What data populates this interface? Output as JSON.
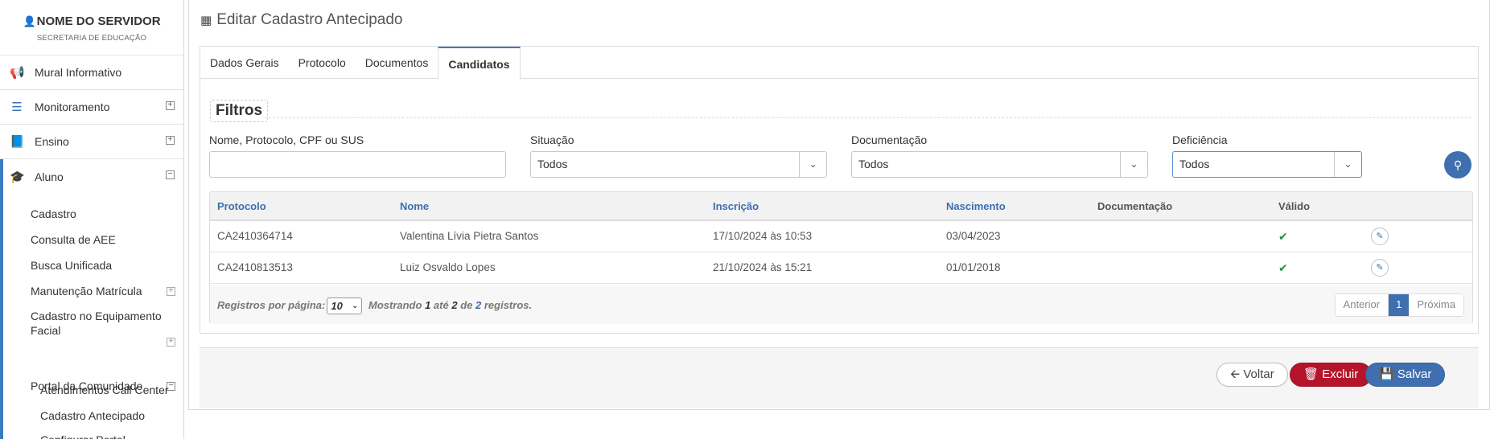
{
  "sidebar": {
    "user_name": "NOME DO SERVIDOR",
    "user_department": "SECRETARIA DE EDUCAÇÃO",
    "items": [
      {
        "label": "Mural Informativo",
        "icon": "megaphone-icon"
      },
      {
        "label": "Monitoramento",
        "icon": "sliders-icon",
        "expand": "⊞"
      },
      {
        "label": "Ensino",
        "icon": "book-icon",
        "expand": "⊞"
      },
      {
        "label": "Aluno",
        "icon": "graduation-cap-icon",
        "expand": "⊟"
      }
    ],
    "sub_items": [
      {
        "label": "Cadastro"
      },
      {
        "label": "Consulta de AEE"
      },
      {
        "label": "Busca Unificada"
      },
      {
        "label": "Manutenção Matrícula"
      },
      {
        "label": "Cadastro no Equipamento Facial"
      },
      {
        "label": "Portal da Comunidade"
      },
      {
        "label": "Atendimentos Call Center"
      },
      {
        "label": "Cadastro Antecipado"
      },
      {
        "label": "Configurar Portal"
      }
    ]
  },
  "page": {
    "title": "Editar Cadastro Antecipado",
    "tabs": [
      "Dados Gerais",
      "Protocolo",
      "Documentos",
      "Candidatos"
    ],
    "active_tab": "Candidatos"
  },
  "filters": {
    "legend": "Filtros",
    "name_label": "Nome, Protocolo, CPF ou SUS",
    "name_value": "",
    "situacao_label": "Situação",
    "situacao_value": "Todos",
    "documentacao_label": "Documentação",
    "documentacao_value": "Todos",
    "deficiencia_label": "Deficiência",
    "deficiencia_value": "Todos"
  },
  "table": {
    "headers": [
      "Protocolo",
      "Nome",
      "Inscrição",
      "Nascimento",
      "Documentação",
      "Válido"
    ],
    "rows": [
      {
        "protocolo": "CA2410364714",
        "nome": "Valentina Lívia Pietra Santos",
        "inscricao": "17/10/2024 às 10:53",
        "nascimento": "03/04/2023",
        "documentacao": "",
        "valido": "✔"
      },
      {
        "protocolo": "CA2410813513",
        "nome": "Luiz Osvaldo Lopes",
        "inscricao": "21/10/2024 às 15:21",
        "nascimento": "01/01/2018",
        "documentacao": "",
        "valido": "✔"
      }
    ],
    "footer": {
      "per_page_label": "Registros por página:",
      "per_page_value": "10",
      "showing": "Mostrando",
      "from": "1",
      "to_word": "até",
      "to": "2",
      "of_word": "de",
      "total": "2",
      "records_word": "registros."
    },
    "pager": {
      "prev": "Anterior",
      "current": "1",
      "next": "Próxima"
    }
  },
  "actions": {
    "back": "Voltar",
    "delete": "Excluir",
    "save": "Salvar"
  },
  "colors": {
    "accent": "#3f6fae",
    "danger": "#b5152b",
    "valid": "#2e8b3a"
  }
}
